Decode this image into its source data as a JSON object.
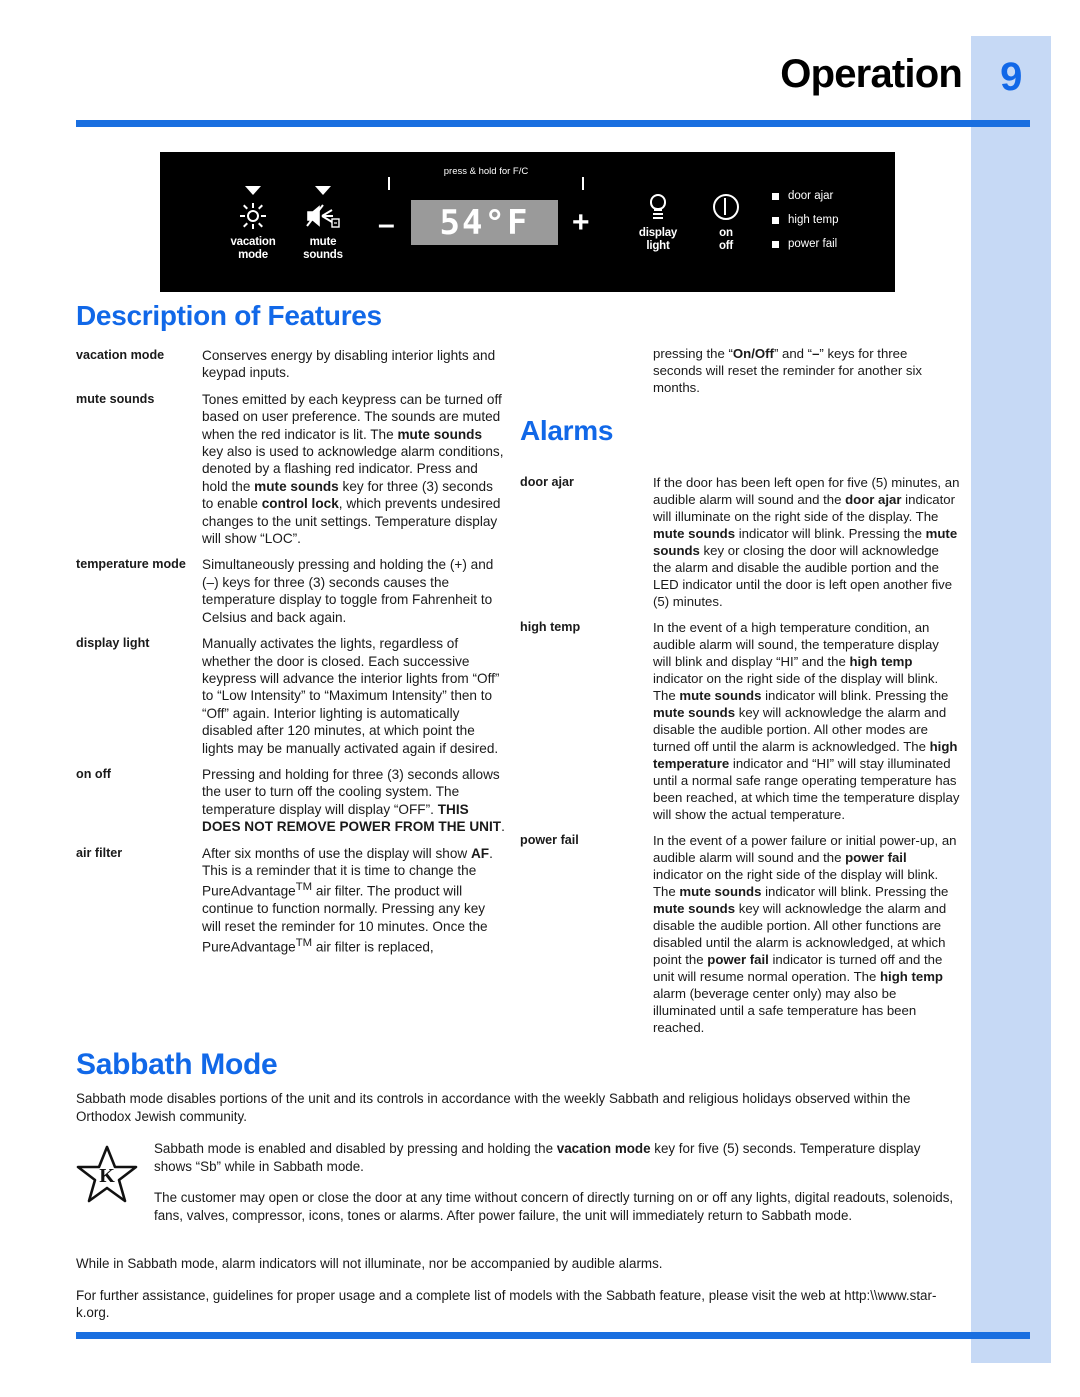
{
  "header": {
    "chapter_title": "Operation",
    "page_number": "9"
  },
  "control_panel": {
    "keys": [
      {
        "name": "vacation-mode",
        "label_line1": "vacation",
        "label_line2": "mode",
        "icon": "sun-icon",
        "has_caret": true
      },
      {
        "name": "mute-sounds",
        "label_line1": "mute",
        "label_line2": "sounds",
        "icon": "mute-speaker-icon",
        "has_caret": true
      },
      {
        "name": "display-light",
        "label_line1": "display",
        "label_line2": "light",
        "icon": "bulb-icon",
        "has_caret": false
      },
      {
        "name": "on-off",
        "label_line1": "on",
        "label_line2": "off",
        "icon": "power-icon",
        "has_caret": false
      }
    ],
    "bracket_label": "press & hold for F/C",
    "minus_sign": "–",
    "plus_sign": "+",
    "temp_value": "54°F",
    "indicators": [
      "door ajar",
      "high temp",
      "power fail"
    ]
  },
  "sections": {
    "description_of_features": "Description of Features",
    "alarms": "Alarms",
    "sabbath_mode": "Sabbath Mode"
  },
  "features": [
    {
      "term": "vacation mode",
      "body": "Conserves energy by disabling interior lights and keypad inputs."
    },
    {
      "term": "mute sounds",
      "body": "Tones emitted by each keypress can be turned off based on user preference.  The sounds are muted when the red indicator is lit.  The <b>mute sounds</b> key also is used to acknowledge alarm conditions, denoted by a flashing red indicator.  Press and hold the <b>mute sounds</b> key for three (3) seconds to enable <b>control lock</b>, which prevents undesired changes to the unit settings.  Temperature display will show “LOC”."
    },
    {
      "term": "temperature mode",
      "body": "Simultaneously pressing and holding the (+) and (–) keys for three (3) seconds causes the temperature display to toggle from Fahrenheit to Celsius and back again."
    },
    {
      "term": "display light",
      "body": "Manually activates the lights, regardless of whether the door is closed.  Each successive keypress will advance the interior lights from “Off” to “Low Intensity” to “Maximum Intensity” then to “Off” again.  Interior lighting is automatically disabled after 120 minutes, at which point the lights may be manually activated again if desired."
    },
    {
      "term": "on off",
      "body": "Pressing and holding for three (3) seconds allows the user to turn off the cooling system.  The temperature display will display “OFF”. <b>THIS DOES NOT REMOVE POWER FROM THE UNIT</b>."
    },
    {
      "term": "air filter",
      "body": "After six months of use the display will show <b>AF</b>.  This is a reminder that it is time to change the PureAdvantage<sup>TM</sup> air filter. The product will continue to function normally.  Pressing any key will reset the reminder for 10 minutes.  Once the PureAdvantage<sup>TM</sup> air filter is replaced,"
    }
  ],
  "air_filter_continued": "pressing the “<b>On/Off</b>” and “<b>–</b>” keys for three seconds will reset the reminder for another six months.",
  "alarms": [
    {
      "term": "door ajar",
      "body": "If the door has been left open for five (5) minutes, an audible alarm will sound and the <b>door ajar</b> indicator will illuminate on the right side of the display.  The <b>mute sounds</b> indicator will blink.  Pressing the <b>mute sounds</b> key or closing the door will acknowledge the alarm and disable the audible portion and the LED indicator until the door is left open another five (5) minutes."
    },
    {
      "term": "high temp",
      "body": "In the event of a high temperature condition, an audible alarm will sound, the temperature display will blink and display “HI” and the <b>high temp</b> indicator on the right side of the display will blink.  The <b>mute sounds</b> indicator will blink.  Pressing the <b>mute sounds</b> key will acknowledge the alarm and disable the audible portion.  All other modes are turned off until the alarm is acknowledged.  The <b>high temperature</b> indicator and “HI” will stay illuminated until a normal safe range operating temperature has been reached, at which time the temperature display will show the actual temperature."
    },
    {
      "term": "power fail",
      "body": "In the event of a power failure or initial power-up, an audible alarm will sound and the <b>power fail</b> indicator on the right side of the display will blink.  The <b>mute sounds</b> indicator will blink.  Pressing the <b>mute sounds</b> key will acknowledge the alarm and disable the audible portion.  All other functions are disabled until the alarm is acknowledged, at which point the <b>power fail</b> indicator is turned off and the unit will resume normal operation.  The <b>high temp</b> alarm (beverage center only) may also be illuminated until a safe temperature has been reached."
    }
  ],
  "sabbath": {
    "intro": "Sabbath mode disables portions of the unit and its controls in accordance with the weekly Sabbath and religious holidays observed within the Orthodox Jewish community.",
    "star_icon_letter": "K",
    "indent_p1": "Sabbath mode is enabled and disabled by pressing and holding the <b>vacation mode</b> key for five (5) seconds.  Temperature display shows “Sb” while in Sabbath mode.",
    "indent_p2": "The customer may open or close the door at any time without concern of directly turning on or off any lights, digital readouts, solenoids, fans, valves, compressor, icons, tones or alarms.  After power failure, the unit will immediately return to Sabbath mode.",
    "tail_p1": "While in Sabbath mode, alarm indicators will not illuminate, nor be accompanied by audible alarms.",
    "tail_p2": "For further assistance, guidelines for proper usage and a complete list of models with the Sabbath feature, please visit the web at http:\\\\www.star-k.org."
  },
  "colors": {
    "accent_blue": "#1168e8",
    "rule_blue": "#1a6fe0",
    "strip_blue": "#c6d9f5",
    "panel_black": "#000000",
    "lcd_grey": "#9a9a9a"
  }
}
